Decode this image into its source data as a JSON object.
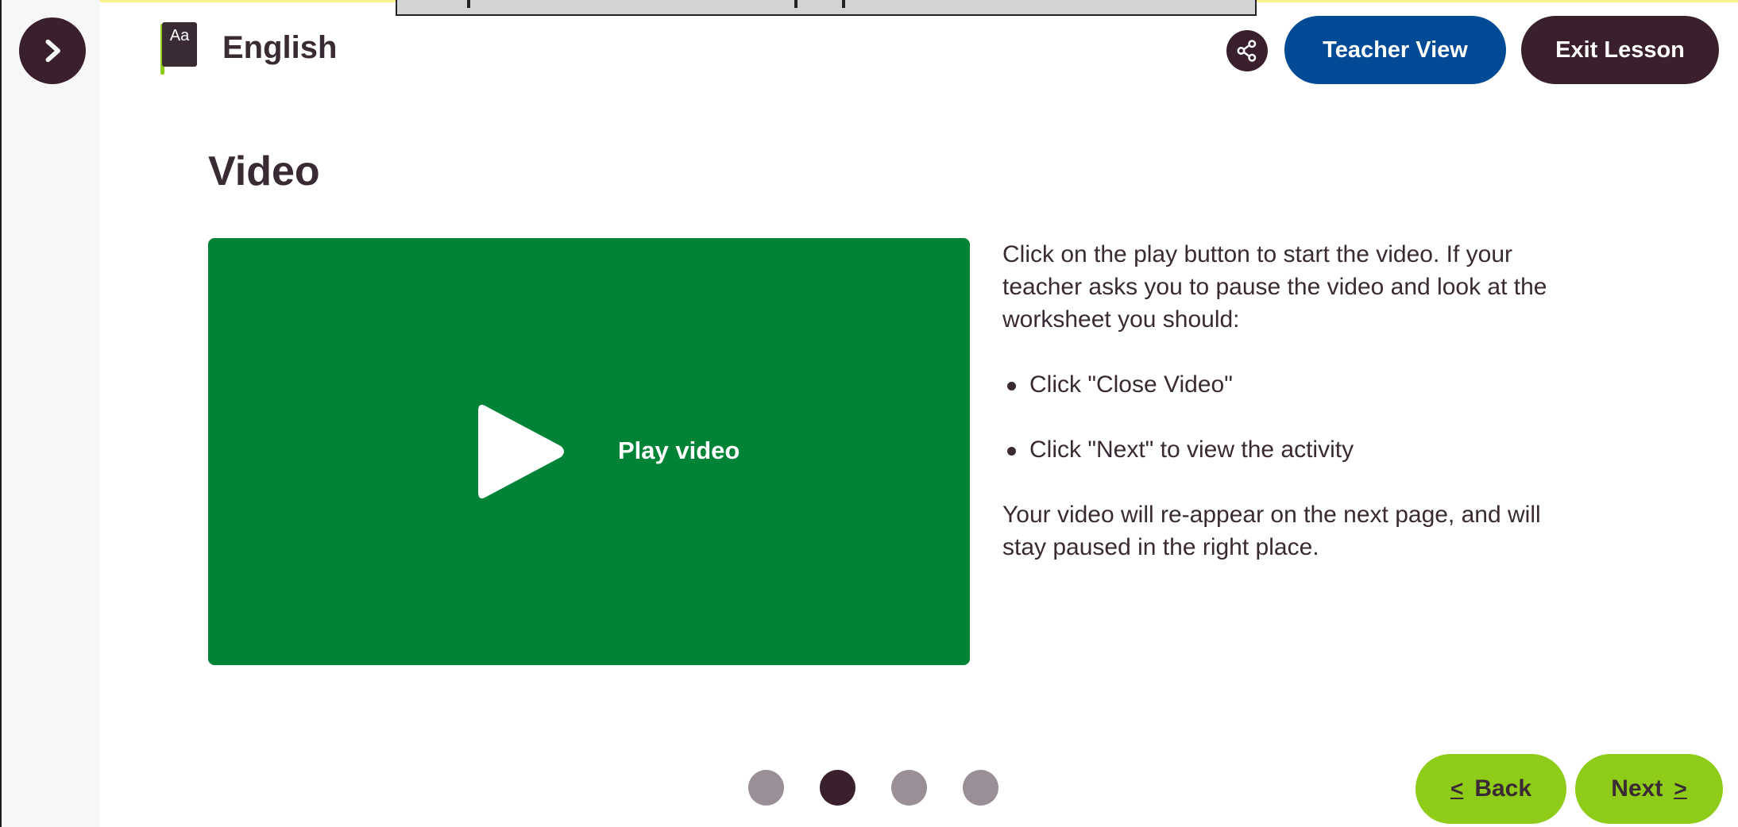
{
  "header": {
    "subject_title": "English",
    "subject_icon_text": "Aa",
    "teacher_view_label": "Teacher View",
    "exit_lesson_label": "Exit Lesson"
  },
  "main": {
    "title": "Video",
    "video": {
      "play_label": "Play video",
      "background_color": "#008237"
    },
    "instructions": {
      "intro": "Click on the play button to start the video. If your teacher asks you to pause the video and look at the worksheet you should:",
      "bullets": [
        "Click \"Close Video\"",
        "Click \"Next\" to view the activity"
      ],
      "outro": "Your video will re-appear on the next page, and will stay paused in the right place."
    }
  },
  "pager": {
    "total": 4,
    "current": 2
  },
  "navigation": {
    "back_label": "Back",
    "next_label": "Next",
    "back_icon": "<",
    "next_icon": ">"
  },
  "colors": {
    "primary_dark": "#3a1f2c",
    "teacher_blue": "#004a96",
    "nav_green": "#8fcc1a"
  }
}
